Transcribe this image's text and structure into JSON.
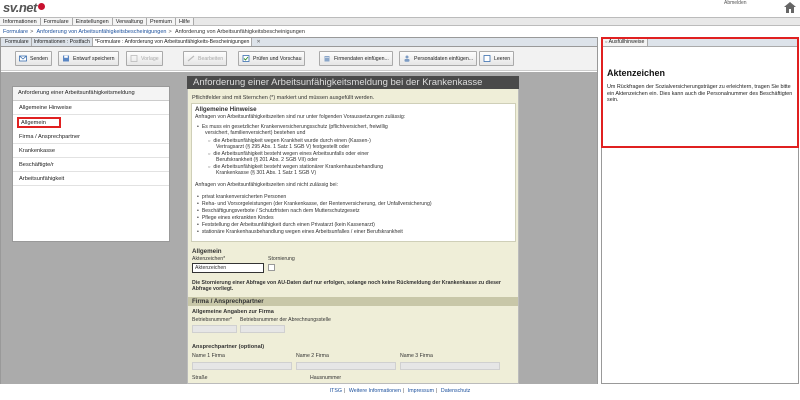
{
  "header": {
    "logo_text": "sv.net",
    "user_text": "Abmelden"
  },
  "menubar": {
    "items": [
      "Informationen",
      "Formulare",
      "Einstellungen",
      "Verwaltung",
      "Premium",
      "Hilfe"
    ]
  },
  "breadcrumb": {
    "items": [
      "Formulare",
      "Anforderung von Arbeitsunfähigkeitsbescheinigungen",
      "Anforderung von Arbeitsunfähigkeitsbescheinigungen"
    ]
  },
  "editor": {
    "tabs": [
      "Formulare",
      "Informationen : Postfach",
      "*Formulare : Anforderung von Arbeitsunfähigkeits-Bescheinigungen"
    ],
    "toolbar": {
      "send": "Senden",
      "draft": "Entwurf speichern",
      "template": "Vorlage",
      "edit": "Bearbeiten",
      "check": "Prüfen und Vorschau",
      "company": "Firmendaten einfügen...",
      "person": "Personaldaten einfügen...",
      "clear": "Leeren"
    }
  },
  "leftnav": {
    "title": "Anforderung einer Arbeitsunfähigkeitsmeldung",
    "items": [
      "Allgemeine Hinweise",
      "Allgemein",
      "Firma / Ansprechpartner",
      "Krankenkasse",
      "Beschäftigte/r",
      "Arbeitsunfähigkeit"
    ]
  },
  "form": {
    "headline": "Anforderung einer Arbeitsunfähigkeitsmeldung bei der Krankenkasse",
    "required_note": "Pflichtfelder sind mit Sternchen (*) markiert und müssen ausgefüllt werden.",
    "hints": {
      "title": "Allgemeine Hinweise",
      "intro": "Anfragen von Arbeitsunfähigkeitszeiten sind nur unter folgenden Voraussetzungen zulässig:",
      "b1": "Es muss ein gesetzlicher Krankenversicherungsschutz (pflichtversichert, freiwillig",
      "b1b": "versichert, familienversichert) bestehen und",
      "c1": "die Arbeitsunfähigkeit wegen Krankheit wurde durch einen (Kassen-)",
      "c1b": "Vertragsarzt (§ 295 Abs. 1 Satz 1 SGB V) festgestellt oder",
      "c2": "die Arbeitsunfähigkeit besteht wegen eines Arbeitsunfalls oder einer",
      "c2b": "Berufskrankheit (§ 201 Abs. 2 SGB VII) oder",
      "c3": "die Arbeitsunfähigkeit besteht wegen stationärer Krankenhausbehandlung",
      "c3b": "Krankenkasse (§ 301 Abs. 1 Satz 1 SGB V)",
      "intro2": "Anfragen von Arbeitsunfähigkeitszeiten sind nicht zulässig bei:",
      "n1": "privat krankenversicherten Personen",
      "n2": "Reha- und Vorsorgeleistungen (der Krankenkasse, der Rentenversicherung, der Unfallversicherung)",
      "n3": "Beschäftigungsverbote / Schutzfristen nach dem Mutterschutzgesetz",
      "n4": "Pflege eines erkrankten Kindes",
      "n5": "Feststellung der Arbeitsunfähigkeit durch einen Privatarzt (kein Kassenarzt)",
      "n6": "stationäre Krankenhausbehandlung wegen eines Arbeitsunfalles / einer Berufskrankheit"
    },
    "allgemein": {
      "title": "Allgemein",
      "aktenzeichen_label": "Aktenzeichen*",
      "aktenzeichen_value": "Aktenzeichen",
      "storno_label": "Stornierung",
      "note": "Die Stornierung einer Abfrage von AU-Daten darf nur erfolgen, solange noch keine Rückmeldung der Krankenkasse zu dieser Abfrage vorliegt."
    },
    "firma": {
      "bar": "Firma / Ansprechpartner",
      "sub1": "Allgemeine Angaben zur Firma",
      "bnr": "Betriebsnummer*",
      "bnr_abr": "Betriebsnummer der Abrechnungsstelle",
      "sub2": "Ansprechpartner (optional)",
      "name1": "Name 1 Firma",
      "name2": "Name 2 Firma",
      "name3": "Name 3 Firma",
      "strasse": "Straße",
      "hausnummer": "Hausnummer"
    }
  },
  "right_panel": {
    "tab": "Ausfüllhinweise",
    "title": "Aktenzeichen",
    "text": "Um Rückfragen der Sozialversicherungsträger zu erleichtern, tragen Sie bitte ein Aktenzeichen ein. Dies kann auch die Personalnummer des Beschäftigten sein."
  },
  "footer": {
    "links": [
      "ITSG",
      "Weitere Informationen",
      "Impressum",
      "Datenschutz"
    ]
  }
}
